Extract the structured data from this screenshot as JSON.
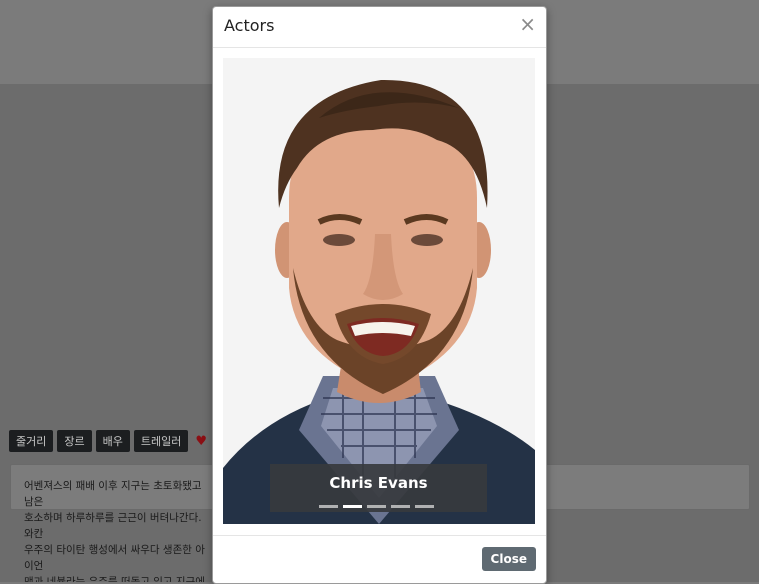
{
  "background": {
    "tabs": [
      {
        "label": "줄거리"
      },
      {
        "label": "장르"
      },
      {
        "label": "배우"
      },
      {
        "label": "트레일러"
      }
    ],
    "heart_icon": "heart-icon",
    "synopsis_text": "어벤져스의 패배 이후 지구는 초토화됐고 남은\n호소하며 하루하루를 근근이 버텨나간다. 와칸\n우주의 타이탄 행성에서 싸우다 생존한 아이언\n맨과 네뷸라는 우주를 떠돌고 있고 지구에 남아\n가 마지막에 신호를 보내다 만 송신기만 들어다\n다리는 중이다. 애초 히어로의 삶을 잠시 내려둔\n이 영식 해야할 수 없는 마음의 상처를 앓은 채"
  },
  "modal": {
    "title": "Actors",
    "close_icon": "×",
    "slide": {
      "caption": "Chris Evans",
      "photo_icon": "actor-portrait-photo"
    },
    "indicators": [
      {
        "active": false
      },
      {
        "active": true
      },
      {
        "active": false
      },
      {
        "active": false
      },
      {
        "active": false
      }
    ],
    "close_label": "Close"
  },
  "colors": {
    "overlay": "#6c6c6c",
    "tab_bg": "#1c1e20",
    "heart": "#8b0f14",
    "close_button": "#5f6a72",
    "caption_bg": "#373a3e"
  }
}
